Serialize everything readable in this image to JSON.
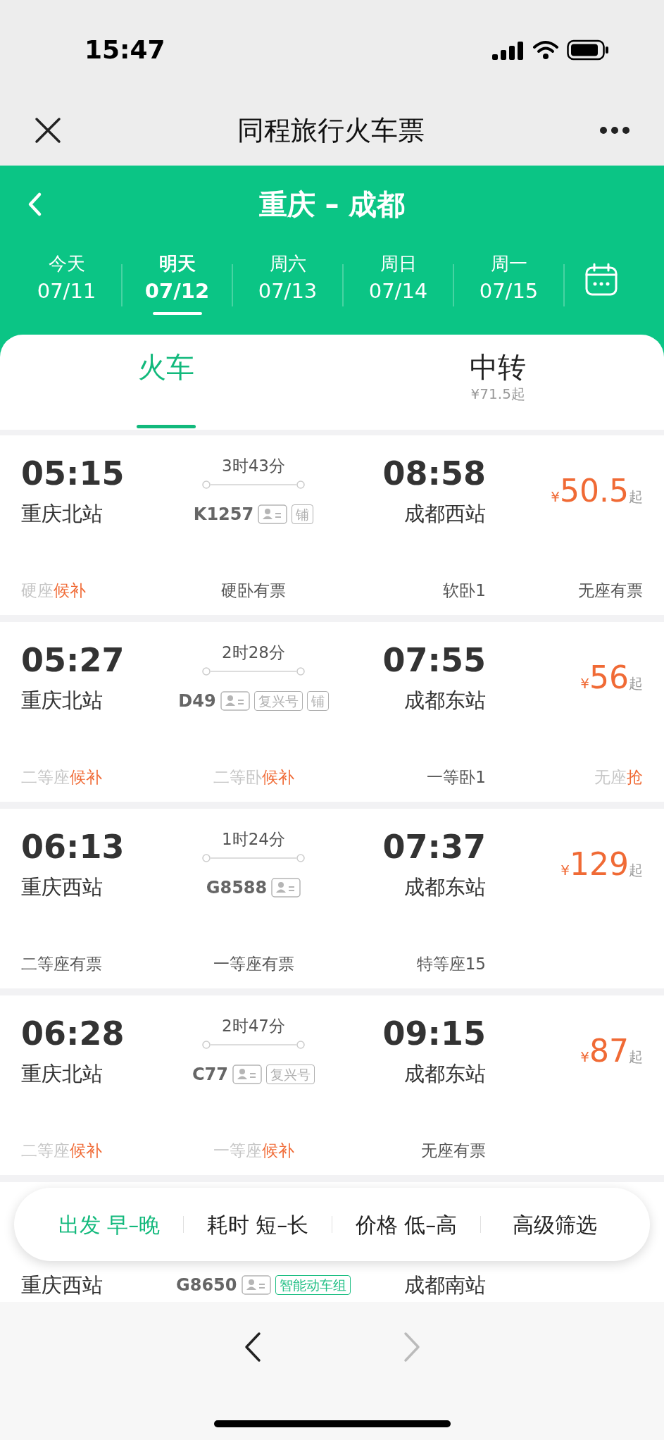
{
  "status_bar": {
    "time": "15:47"
  },
  "title_bar": {
    "title": "同程旅行火车票"
  },
  "header": {
    "route": "重庆 – 成都"
  },
  "dates": [
    {
      "weekday": "今天",
      "date": "07/11",
      "selected": false
    },
    {
      "weekday": "明天",
      "date": "07/12",
      "selected": true
    },
    {
      "weekday": "周六",
      "date": "07/13",
      "selected": false
    },
    {
      "weekday": "周日",
      "date": "07/14",
      "selected": false
    },
    {
      "weekday": "周一",
      "date": "07/15",
      "selected": false
    }
  ],
  "tabs": [
    {
      "label": "火车",
      "selected": true
    },
    {
      "label": "中转",
      "sub": "¥71.5起",
      "selected": false
    }
  ],
  "trains": [
    {
      "depart": "05:15",
      "from": "重庆北站",
      "duration": "3时43分",
      "number": "K1257",
      "badges": [
        {
          "kind": "id"
        },
        {
          "kind": "tag",
          "label": "铺",
          "color": "#b0b0b0"
        }
      ],
      "arrive": "08:58",
      "to": "成都西站",
      "currency": "¥",
      "price": "50.5",
      "suffix": "起",
      "seats": [
        {
          "name": "硬座",
          "status": "候补",
          "available": false
        },
        {
          "name": "硬卧",
          "status": "有票",
          "available": true
        },
        {
          "name": "软卧",
          "status": "1",
          "available": true
        },
        {
          "name": "无座",
          "status": "有票",
          "available": true
        }
      ]
    },
    {
      "depart": "05:27",
      "from": "重庆北站",
      "duration": "2时28分",
      "number": "D49",
      "badges": [
        {
          "kind": "id"
        },
        {
          "kind": "tag",
          "label": "复兴号",
          "color": "#b0b0b0"
        },
        {
          "kind": "tag",
          "label": "铺",
          "color": "#b0b0b0"
        }
      ],
      "arrive": "07:55",
      "to": "成都东站",
      "currency": "¥",
      "price": "56",
      "suffix": "起",
      "seats": [
        {
          "name": "二等座",
          "status": "候补",
          "available": false
        },
        {
          "name": "二等卧",
          "status": "候补",
          "available": false
        },
        {
          "name": "一等卧",
          "status": "1",
          "available": true
        },
        {
          "name": "无座",
          "status": "抢",
          "available": false
        }
      ]
    },
    {
      "depart": "06:13",
      "from": "重庆西站",
      "duration": "1时24分",
      "number": "G8588",
      "badges": [
        {
          "kind": "id"
        }
      ],
      "arrive": "07:37",
      "to": "成都东站",
      "currency": "¥",
      "price": "129",
      "suffix": "起",
      "seats": [
        {
          "name": "二等座",
          "status": "有票",
          "available": true
        },
        {
          "name": "一等座",
          "status": "有票",
          "available": true
        },
        {
          "name": "特等座",
          "status": "15",
          "available": true
        }
      ]
    },
    {
      "depart": "06:28",
      "from": "重庆北站",
      "duration": "2时47分",
      "number": "C77",
      "badges": [
        {
          "kind": "id"
        },
        {
          "kind": "tag",
          "label": "复兴号",
          "color": "#b0b0b0"
        }
      ],
      "arrive": "09:15",
      "to": "成都东站",
      "currency": "¥",
      "price": "87",
      "suffix": "起",
      "seats": [
        {
          "name": "二等座",
          "status": "候补",
          "available": false
        },
        {
          "name": "一等座",
          "status": "候补",
          "available": false
        },
        {
          "name": "无座",
          "status": "有票",
          "available": true
        }
      ]
    }
  ],
  "partial_train": {
    "from": "重庆西站",
    "number": "G8650",
    "badges": [
      {
        "kind": "id"
      },
      {
        "kind": "tag",
        "label": "智能动车组",
        "color": "#1fbf84"
      }
    ],
    "to": "成都南站"
  },
  "filters": [
    {
      "label": "出发 早–晚",
      "selected": true
    },
    {
      "label": "耗时 短–长",
      "selected": false
    },
    {
      "label": "价格 低–高",
      "selected": false
    },
    {
      "label": "高级筛选",
      "selected": false
    }
  ],
  "nav": {
    "back_disabled": false,
    "forward_disabled": true
  }
}
